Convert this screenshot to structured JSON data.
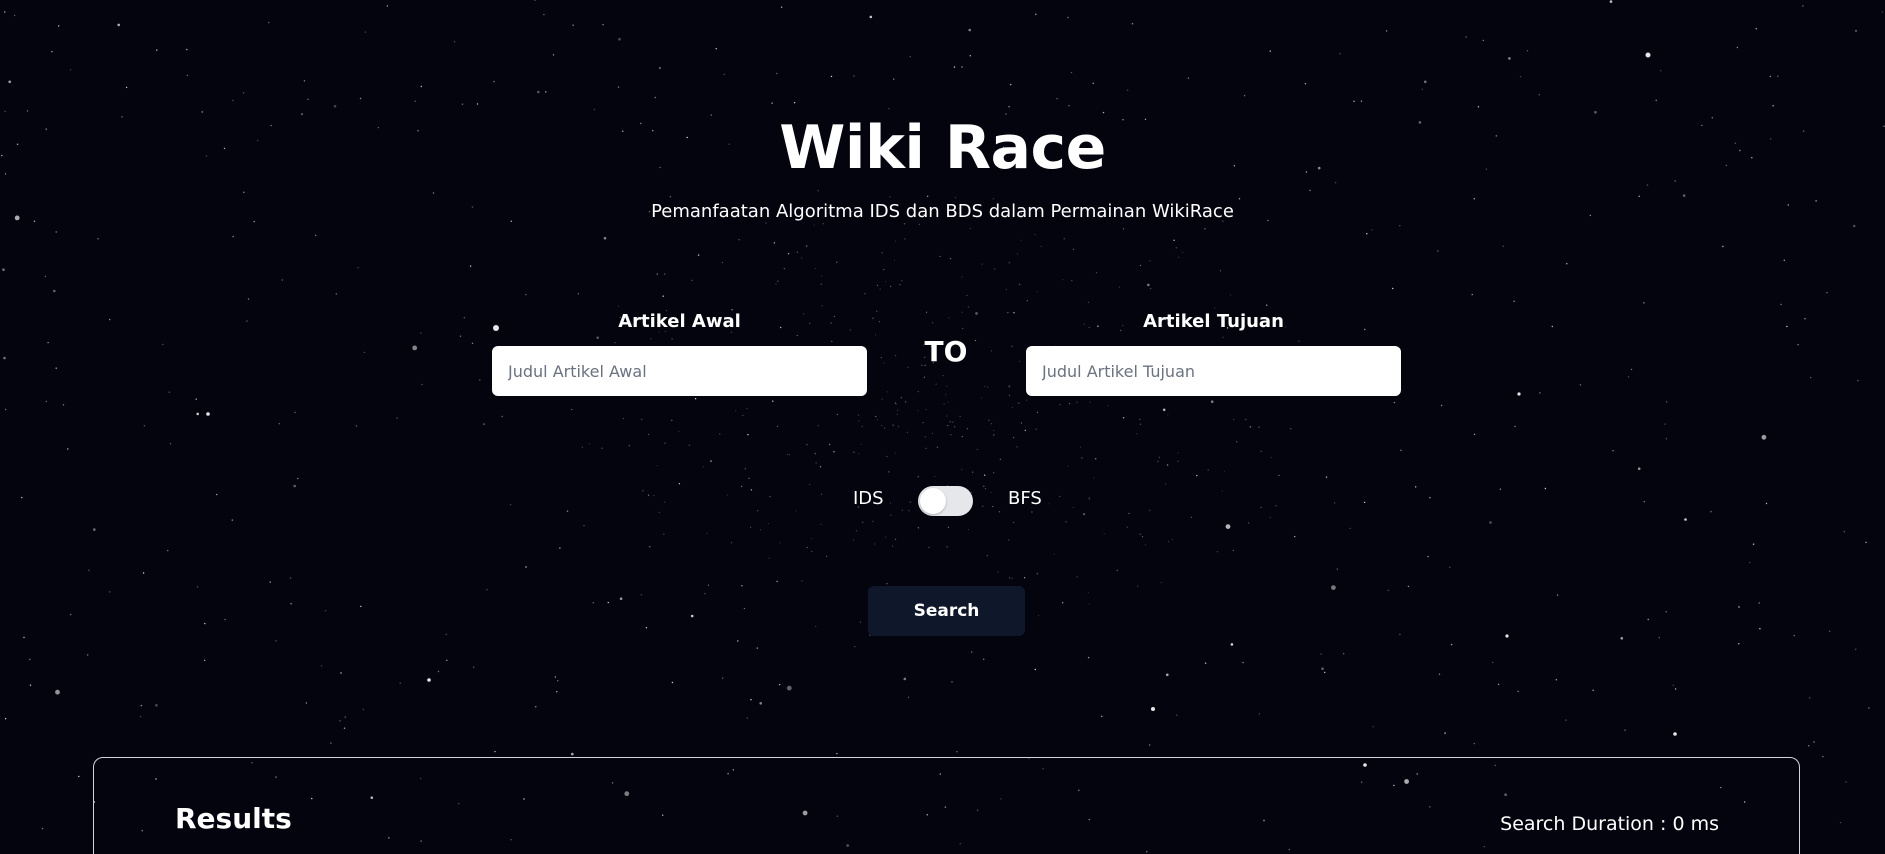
{
  "header": {
    "title": "Wiki Race",
    "subtitle": "Pemanfaatan Algoritma IDS dan BDS dalam Permainan WikiRace"
  },
  "form": {
    "start": {
      "label": "Artikel Awal",
      "placeholder": "Judul Artikel Awal",
      "value": ""
    },
    "connector": "TO",
    "target": {
      "label": "Artikel Tujuan",
      "placeholder": "Judul Artikel Tujuan",
      "value": ""
    }
  },
  "algorithm": {
    "left_label": "IDS",
    "right_label": "BFS",
    "selected": "IDS"
  },
  "search_button": {
    "label": "Search"
  },
  "results": {
    "title": "Results",
    "duration_text": "Search Duration : 0 ms"
  },
  "colors": {
    "background": "#04040f",
    "button": "#0f172a",
    "toggle_track": "#e5e7eb",
    "panel_border": "#d1d5db"
  },
  "icons": {
    "background": "starfield-icon"
  }
}
